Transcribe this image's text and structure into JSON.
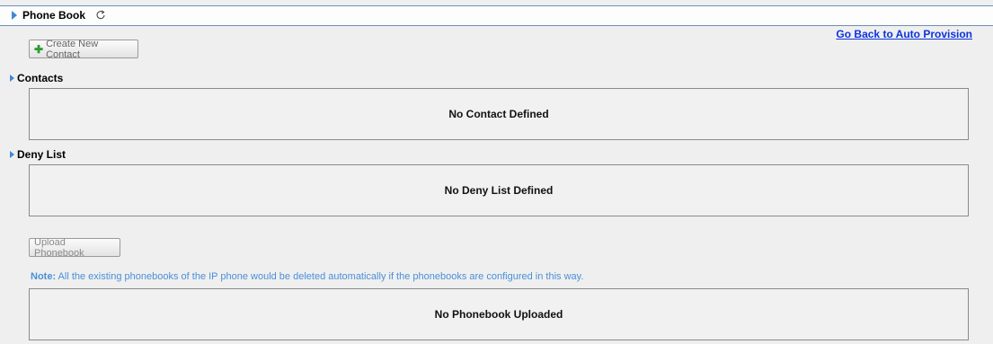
{
  "header": {
    "title": "Phone Book",
    "refresh_icon": "refresh-icon"
  },
  "nav": {
    "back_link": "Go Back to Auto Provision"
  },
  "toolbar": {
    "create_contact_label": "Create New Contact",
    "create_icon": "plus-icon"
  },
  "contacts": {
    "title": "Contacts",
    "empty_text": "No Contact Defined"
  },
  "deny_list": {
    "title": "Deny List",
    "empty_text": "No Deny List Defined"
  },
  "phonebook": {
    "upload_label": "Upload Phonebook",
    "note_label": "Note:",
    "note_text": " All the existing phonebooks of the IP phone would be deleted automatically if the phonebooks are configured in this way.",
    "empty_text": "No Phonebook Uploaded"
  },
  "colors": {
    "accent": "#3f87d6",
    "link": "#0b33e0",
    "note": "#4a8fd8",
    "plus": "#2e9b2e"
  }
}
